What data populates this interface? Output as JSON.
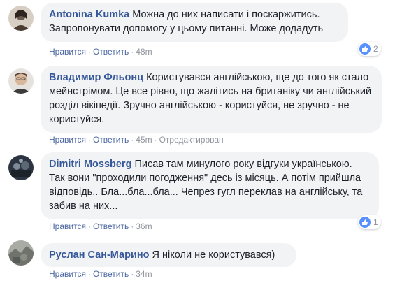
{
  "comments": [
    {
      "author": "Antonina Kumka",
      "text": "Можна до них написати і поскаржитись. Запропонувати допомогу у цьому питанні. Може додадуть",
      "like": "Нравится",
      "reply": "Ответить",
      "time": "48m",
      "edited": "",
      "reactions": "2",
      "avatar_color": "#6b5a4e"
    },
    {
      "author": "Владимир Фльонц",
      "text": "Користувався англійською, ще до того як стало мейнстрімом. Це все рівно, що жалітись на британіку чи англійський розділ вікіпедії. Зручно англійською - користуйся, не зручно - не користуйся.",
      "like": "Нравится",
      "reply": "Ответить",
      "time": "45m",
      "edited": "Отредактирован",
      "reactions": "",
      "avatar_color": "#c9a58a"
    },
    {
      "author": "Dimitri Mossberg",
      "text": "Писав там минулого року відгуки українською. Так вони \"проходили погодження\" десь із місяць. А потім прийшла відповідь.. Бла...бла...бла... Чепрез гугл переклав на англійську, та забив на них...",
      "like": "Нравится",
      "reply": "Ответить",
      "time": "36m",
      "edited": "",
      "reactions": "1",
      "avatar_color": "#3d4a5a"
    },
    {
      "author": "Руслан Сан-Марино",
      "text": "Я ніколи не користувався)",
      "like": "Нравится",
      "reply": "Ответить",
      "time": "34m",
      "edited": "",
      "reactions": "",
      "avatar_color": "#8a8d86"
    }
  ],
  "colors": {
    "name": "#365899",
    "bubble": "#f2f3f5",
    "meta": "#90949c",
    "like_badge": "#5890ff"
  }
}
